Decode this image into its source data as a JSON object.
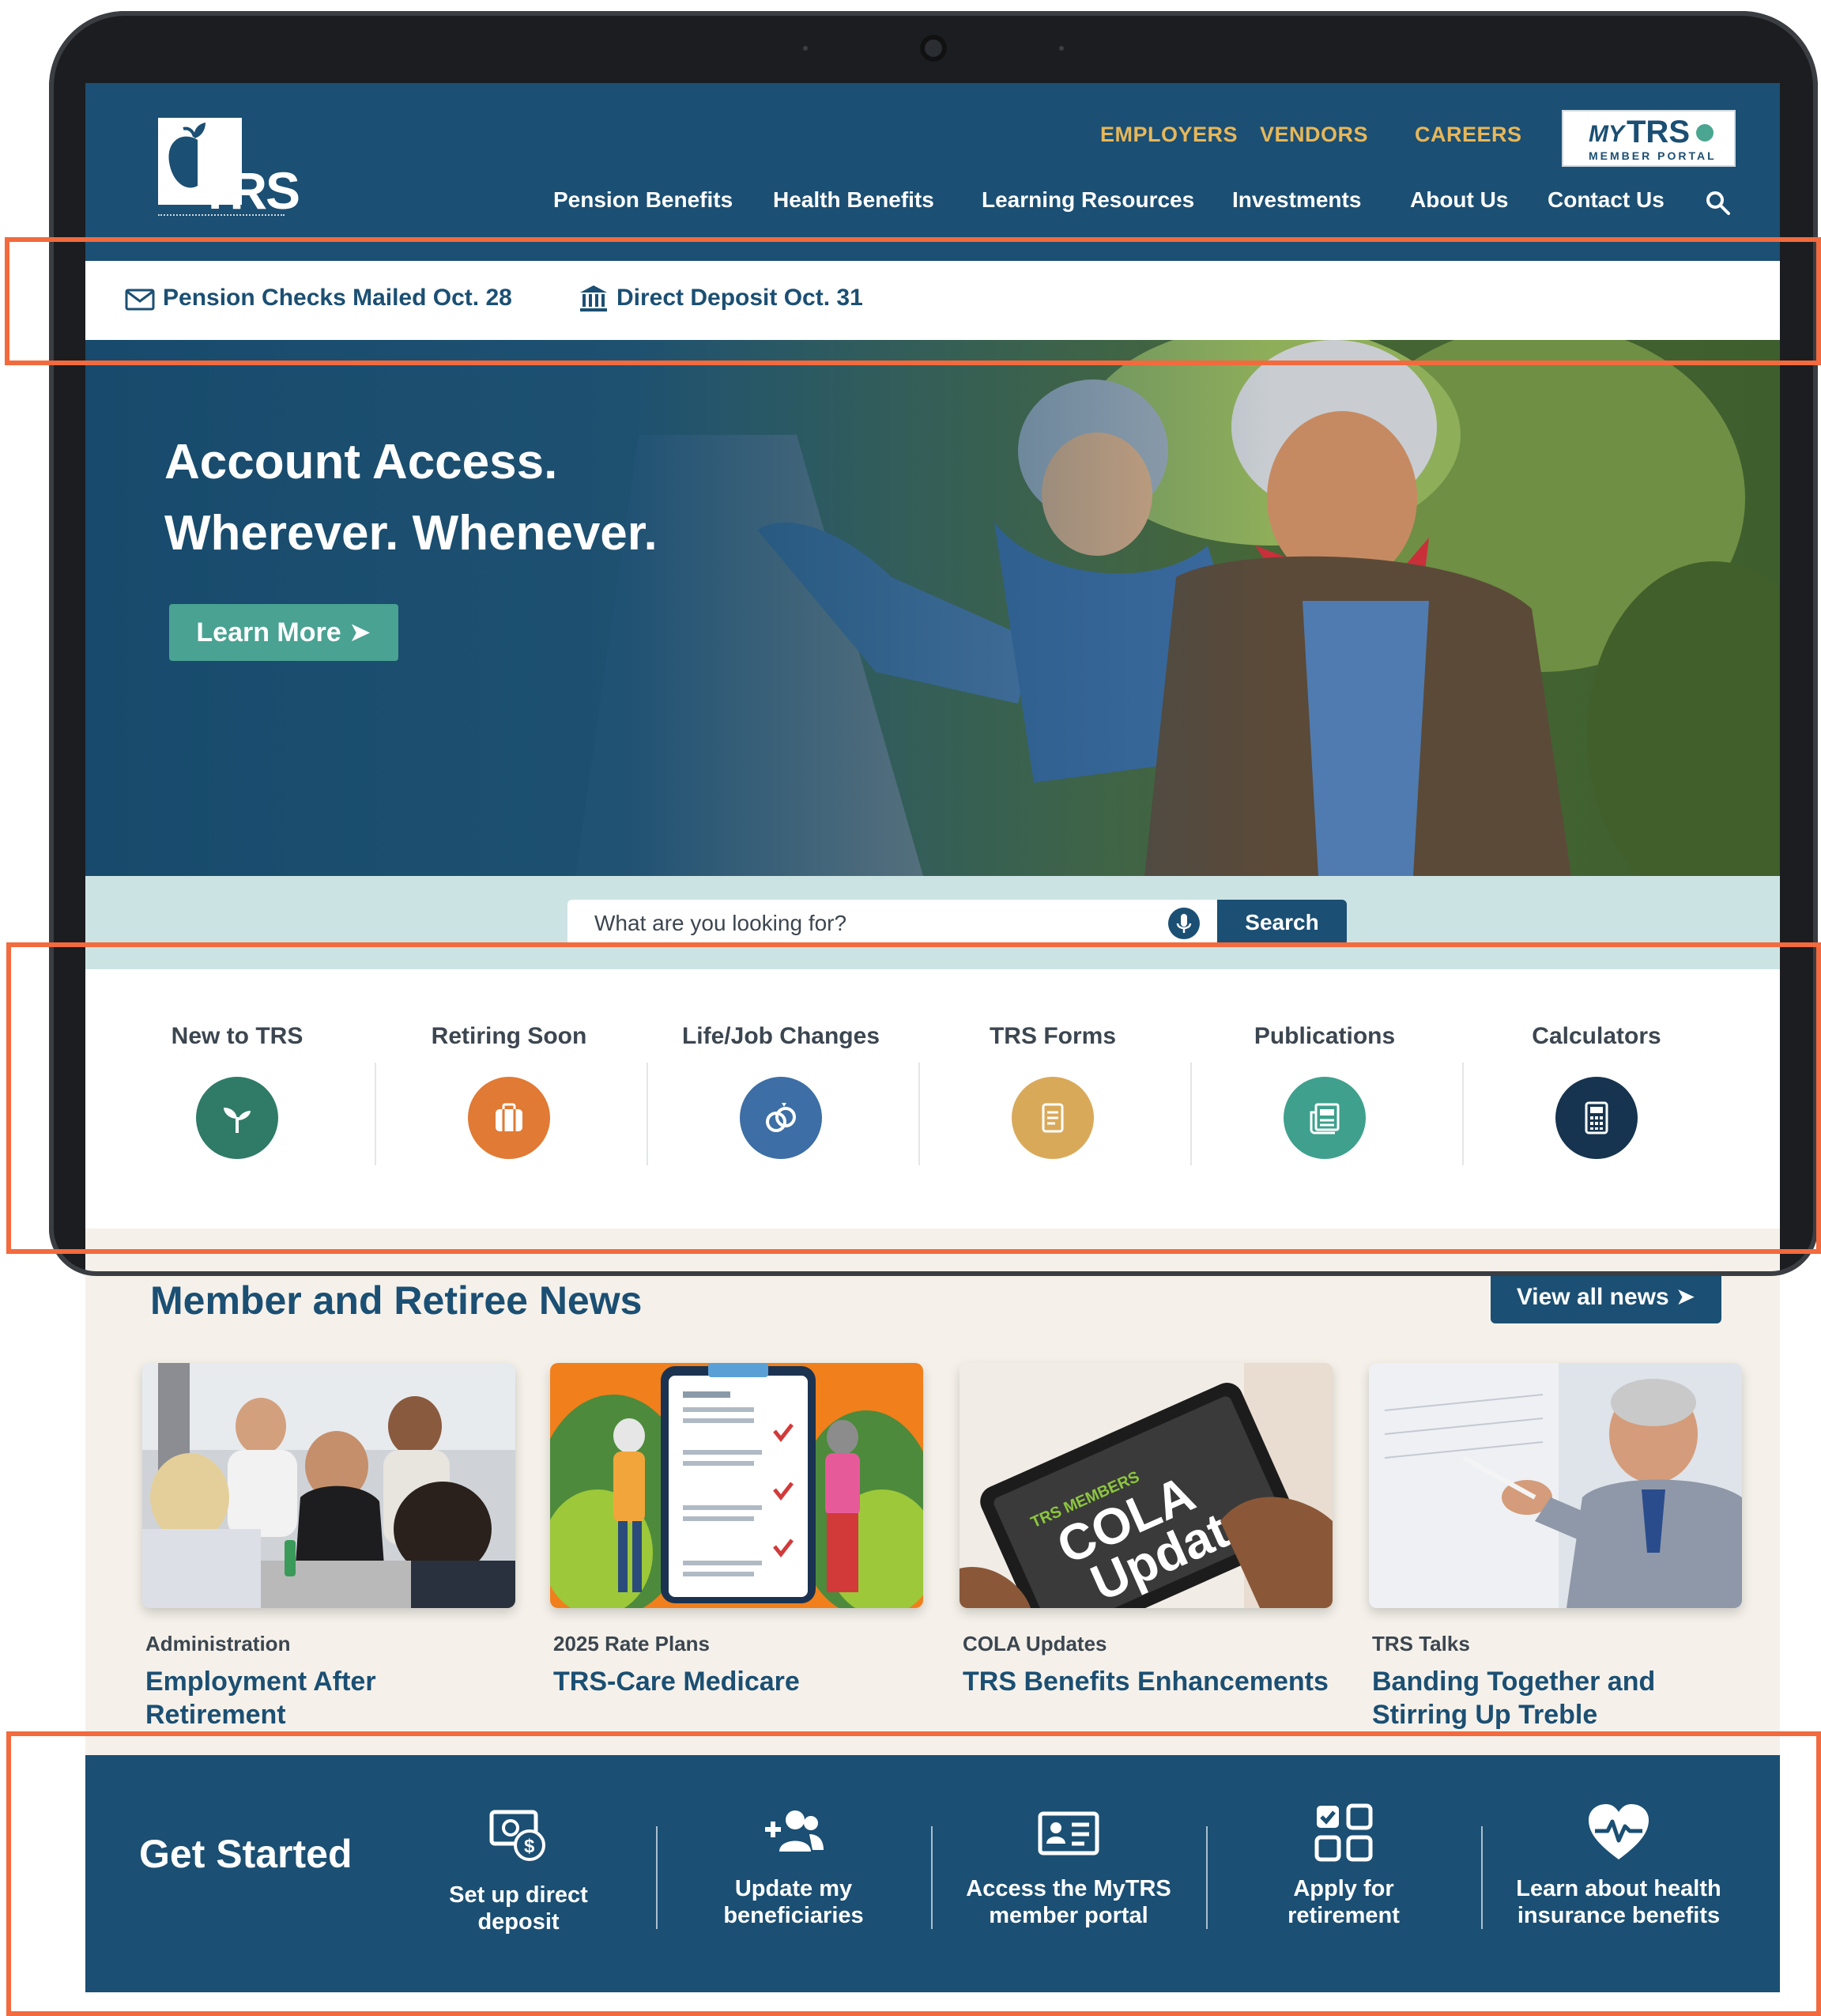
{
  "header": {
    "logo_text": "TRS",
    "util_nav": [
      {
        "label": "EMPLOYERS"
      },
      {
        "label": "VENDORS"
      },
      {
        "label": "CAREERS"
      }
    ],
    "portal": {
      "my": "MY",
      "trs": "TRS",
      "sub": "MEMBER PORTAL"
    },
    "main_nav": [
      {
        "label": "Pension Benefits"
      },
      {
        "label": "Health Benefits"
      },
      {
        "label": "Learning Resources"
      },
      {
        "label": "Investments"
      },
      {
        "label": "About Us"
      },
      {
        "label": "Contact Us"
      }
    ]
  },
  "alerts": [
    {
      "text": "Pension Checks Mailed  Oct. 28",
      "icon": "envelope-icon"
    },
    {
      "text": "Direct Deposit Oct. 31",
      "icon": "bank-icon"
    }
  ],
  "hero": {
    "line1": "Account Access.",
    "line2": "Wherever. Whenever.",
    "button": "Learn More ➤"
  },
  "search": {
    "placeholder": "What are you looking for?",
    "button": "Search"
  },
  "quick_links": [
    {
      "label": "New to TRS",
      "icon": "sprout-icon",
      "color": "#2f7b68"
    },
    {
      "label": "Retiring Soon",
      "icon": "suitcase-icon",
      "color": "#e07a34"
    },
    {
      "label": "Life/Job Changes",
      "icon": "rings-icon",
      "color": "#3d6ea5"
    },
    {
      "label": "TRS Forms",
      "icon": "document-icon",
      "color": "#d9a95a"
    },
    {
      "label": "Publications",
      "icon": "newspaper-icon",
      "color": "#3fa08d"
    },
    {
      "label": "Calculators",
      "icon": "calculator-icon",
      "color": "#16344f"
    }
  ],
  "news": {
    "title": "Member and Retiree News",
    "view_all": "View all news ➤",
    "cards": [
      {
        "category": "Administration",
        "title": "Employment After Retirement"
      },
      {
        "category": "2025 Rate Plans",
        "title": "TRS-Care Medicare"
      },
      {
        "category": "COLA Updates",
        "title": "TRS Benefits Enhancements"
      },
      {
        "category": "TRS Talks",
        "title": "Banding Together and Stirring Up Treble"
      }
    ],
    "cola_image": {
      "small": "TRS MEMBERS",
      "line1": "COLA",
      "line2": "Update"
    }
  },
  "get_started": {
    "title": "Get Started",
    "items": [
      {
        "line1": "Set up direct",
        "line2": "deposit",
        "icon": "money-icon"
      },
      {
        "line1": "Update my",
        "line2": "beneficiaries",
        "icon": "add-user-icon"
      },
      {
        "line1": "Access the MyTRS",
        "line2": "member portal",
        "icon": "id-card-icon"
      },
      {
        "line1": "Apply for",
        "line2": "retirement",
        "icon": "checklist-icon"
      },
      {
        "line1": "Learn about health",
        "line2": "insurance benefits",
        "icon": "heart-pulse-icon"
      }
    ]
  },
  "colors": {
    "navy": "#1b4f73",
    "gold": "#e7b75a",
    "teal": "#49a292",
    "annotation": "#f26a3d"
  }
}
